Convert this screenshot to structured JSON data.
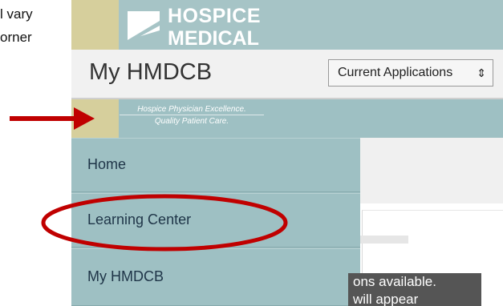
{
  "doc_fragments": {
    "line1": "l vary",
    "line2": "orner"
  },
  "logo": {
    "line1": "HOSPICE",
    "line2": "MEDICAL"
  },
  "header": {
    "title": "My HMDCB",
    "dropdown_value": "Current Applications",
    "dropdown_chevron": "⇕"
  },
  "tagline": {
    "line1": "Hospice Physician Excellence.",
    "line2": "Quality Patient Care."
  },
  "nav": {
    "items": [
      {
        "label": "Home"
      },
      {
        "label": "Learning Center"
      },
      {
        "label": "My HMDCB"
      }
    ]
  },
  "content": {
    "tooltip_line1": "ons available.",
    "tooltip_line2": "will appear"
  },
  "colors": {
    "teal": "#9ec0c3",
    "gold": "#d6cf9c",
    "nav_text": "#1f3548",
    "annotation_red": "#c00000"
  },
  "annotations": {
    "arrow_color": "#c00000",
    "ellipse_color": "#c00000",
    "ellipse_target": "Learning Center"
  }
}
